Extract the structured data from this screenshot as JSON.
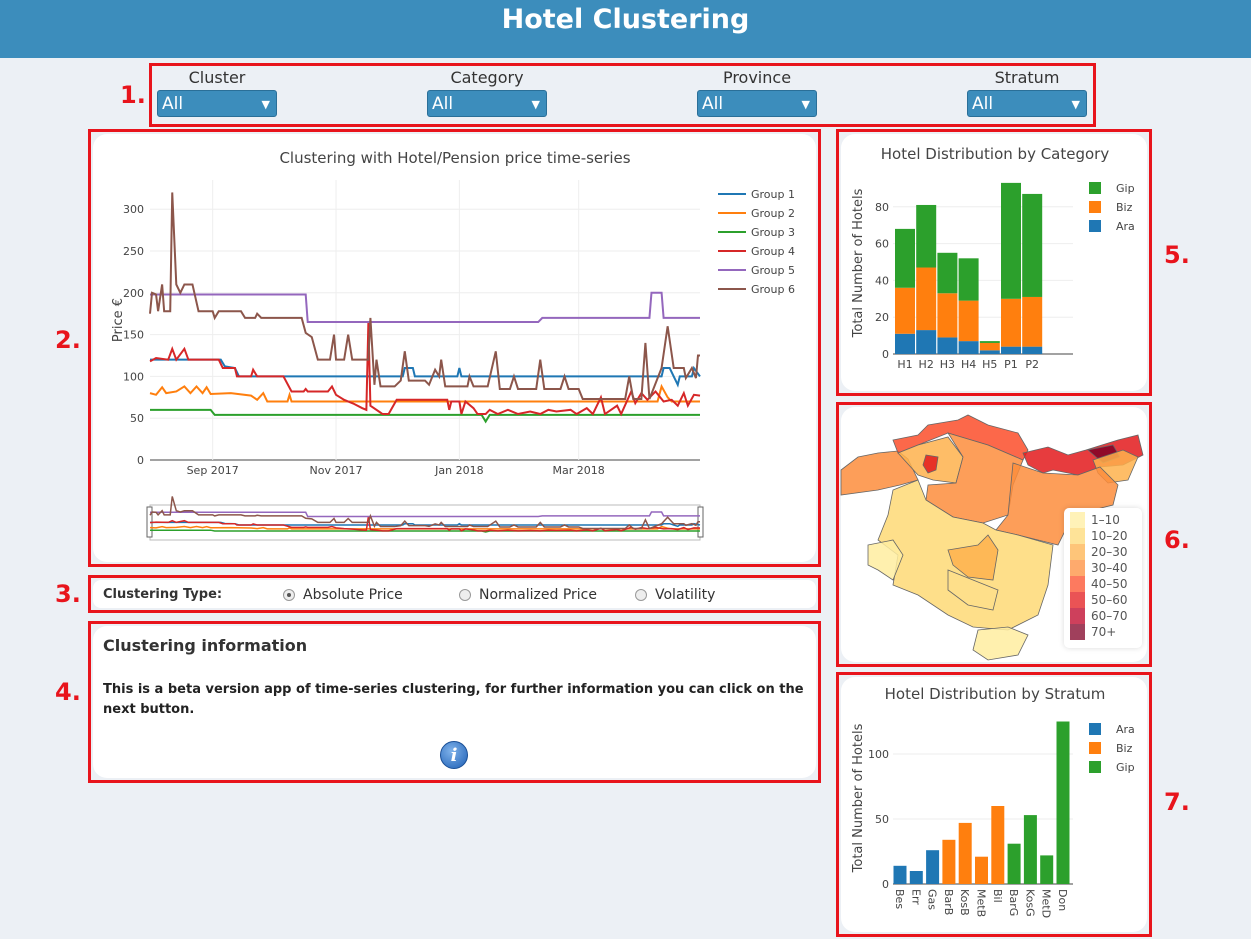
{
  "header": {
    "title": "Hotel Clustering"
  },
  "annotations": [
    "1.",
    "2.",
    "3.",
    "4.",
    "5.",
    "6.",
    "7."
  ],
  "filters": [
    {
      "label": "Cluster",
      "value": "All"
    },
    {
      "label": "Category",
      "value": "All"
    },
    {
      "label": "Province",
      "value": "All"
    },
    {
      "label": "Stratum",
      "value": "All"
    }
  ],
  "timeseries": {
    "title": "Clustering with Hotel/Pension price time-series",
    "ylabel": "Price €",
    "yticks": [
      0,
      50,
      100,
      150,
      200,
      250,
      300
    ],
    "xticks": [
      {
        "date": "2017-09-01",
        "label": "Sep 2017"
      },
      {
        "date": "2017-11-01",
        "label": "Nov 2017"
      },
      {
        "date": "2018-01-01",
        "label": "Jan 2018"
      },
      {
        "date": "2018-03-01",
        "label": "Mar 2018"
      }
    ],
    "xrange": [
      "2017-08-01",
      "2018-04-30"
    ],
    "yrange": [
      0,
      325
    ],
    "series": [
      {
        "name": "Group 1",
        "color": "#1f77b4",
        "points": [
          [
            "2017-08-01",
            120
          ],
          [
            "2017-09-05",
            120
          ],
          [
            "2017-09-07",
            112
          ],
          [
            "2017-09-12",
            110
          ],
          [
            "2017-09-14",
            100
          ],
          [
            "2017-12-04",
            100
          ],
          [
            "2017-12-05",
            110
          ],
          [
            "2017-12-09",
            110
          ],
          [
            "2017-12-10",
            100
          ],
          [
            "2017-12-31",
            100
          ],
          [
            "2018-01-01",
            110
          ],
          [
            "2018-01-02",
            100
          ],
          [
            "2018-04-11",
            100
          ],
          [
            "2018-04-12",
            110
          ],
          [
            "2018-04-15",
            110
          ],
          [
            "2018-04-17",
            100
          ],
          [
            "2018-04-19",
            90
          ],
          [
            "2018-04-20",
            100
          ],
          [
            "2018-04-26",
            100
          ],
          [
            "2018-04-27",
            110
          ],
          [
            "2018-04-30",
            100
          ]
        ]
      },
      {
        "name": "Group 2",
        "color": "#ff7f0e",
        "points": [
          [
            "2017-08-01",
            80
          ],
          [
            "2017-08-04",
            78
          ],
          [
            "2017-08-07",
            87
          ],
          [
            "2017-08-09",
            80
          ],
          [
            "2017-08-14",
            82
          ],
          [
            "2017-08-18",
            88
          ],
          [
            "2017-08-21",
            80
          ],
          [
            "2017-08-24",
            88
          ],
          [
            "2017-08-27",
            80
          ],
          [
            "2017-08-29",
            87
          ],
          [
            "2017-08-31",
            79
          ],
          [
            "2017-09-10",
            80
          ],
          [
            "2017-09-20",
            77
          ],
          [
            "2017-09-23",
            72
          ],
          [
            "2017-09-26",
            80
          ],
          [
            "2017-09-28",
            70
          ],
          [
            "2017-10-08",
            70
          ],
          [
            "2017-10-09",
            78
          ],
          [
            "2017-10-10",
            70
          ],
          [
            "2018-04-09",
            70
          ],
          [
            "2018-04-11",
            88
          ],
          [
            "2018-04-14",
            75
          ],
          [
            "2018-04-16",
            70
          ],
          [
            "2018-04-30",
            70
          ]
        ]
      },
      {
        "name": "Group 3",
        "color": "#2ca02c",
        "points": [
          [
            "2017-08-01",
            60
          ],
          [
            "2017-08-31",
            60
          ],
          [
            "2017-09-02",
            54
          ],
          [
            "2018-01-12",
            54
          ],
          [
            "2018-01-14",
            46
          ],
          [
            "2018-01-16",
            54
          ],
          [
            "2018-04-30",
            54
          ]
        ]
      },
      {
        "name": "Group 4",
        "color": "#d62728",
        "points": [
          [
            "2017-08-01",
            118
          ],
          [
            "2017-08-04",
            122
          ],
          [
            "2017-08-10",
            120
          ],
          [
            "2017-08-12",
            133
          ],
          [
            "2017-08-14",
            120
          ],
          [
            "2017-08-18",
            133
          ],
          [
            "2017-08-20",
            120
          ],
          [
            "2017-09-04",
            120
          ],
          [
            "2017-09-06",
            110
          ],
          [
            "2017-09-12",
            110
          ],
          [
            "2017-09-13",
            100
          ],
          [
            "2017-09-20",
            100
          ],
          [
            "2017-09-21",
            108
          ],
          [
            "2017-09-23",
            100
          ],
          [
            "2017-10-06",
            100
          ],
          [
            "2017-10-10",
            82
          ],
          [
            "2017-10-16",
            82
          ],
          [
            "2017-10-17",
            85
          ],
          [
            "2017-10-18",
            82
          ],
          [
            "2017-10-28",
            82
          ],
          [
            "2017-10-30",
            88
          ],
          [
            "2017-11-01",
            78
          ],
          [
            "2017-11-05",
            72
          ],
          [
            "2017-11-10",
            67
          ],
          [
            "2017-11-14",
            62
          ],
          [
            "2017-11-16",
            60
          ],
          [
            "2017-11-17",
            165
          ],
          [
            "2017-11-18",
            65
          ],
          [
            "2017-11-24",
            55
          ],
          [
            "2017-11-27",
            55
          ],
          [
            "2017-12-01",
            72
          ],
          [
            "2017-12-26",
            72
          ],
          [
            "2017-12-27",
            60
          ],
          [
            "2017-12-28",
            70
          ],
          [
            "2018-01-01",
            70
          ],
          [
            "2018-01-02",
            55
          ],
          [
            "2018-01-04",
            70
          ],
          [
            "2018-01-08",
            62
          ],
          [
            "2018-01-10",
            55
          ],
          [
            "2018-01-14",
            55
          ],
          [
            "2018-01-16",
            60
          ],
          [
            "2018-01-20",
            55
          ],
          [
            "2018-01-25",
            60
          ],
          [
            "2018-01-30",
            55
          ],
          [
            "2018-02-05",
            58
          ],
          [
            "2018-02-10",
            55
          ],
          [
            "2018-02-14",
            60
          ],
          [
            "2018-02-18",
            58
          ],
          [
            "2018-02-25",
            60
          ],
          [
            "2018-02-28",
            55
          ],
          [
            "2018-03-05",
            62
          ],
          [
            "2018-03-08",
            55
          ],
          [
            "2018-03-12",
            75
          ],
          [
            "2018-03-14",
            55
          ],
          [
            "2018-03-20",
            65
          ],
          [
            "2018-03-22",
            55
          ],
          [
            "2018-03-27",
            82
          ],
          [
            "2018-03-29",
            68
          ],
          [
            "2018-04-01",
            80
          ],
          [
            "2018-04-04",
            72
          ],
          [
            "2018-04-08",
            82
          ],
          [
            "2018-04-12",
            70
          ],
          [
            "2018-04-16",
            72
          ],
          [
            "2018-04-19",
            65
          ],
          [
            "2018-04-22",
            80
          ],
          [
            "2018-04-24",
            65
          ],
          [
            "2018-04-27",
            78
          ],
          [
            "2018-04-30",
            77
          ]
        ]
      },
      {
        "name": "Group 5",
        "color": "#9467bd",
        "points": [
          [
            "2017-08-01",
            198
          ],
          [
            "2017-10-17",
            198
          ],
          [
            "2017-10-18",
            165
          ],
          [
            "2018-02-09",
            165
          ],
          [
            "2018-02-11",
            170
          ],
          [
            "2018-04-05",
            170
          ],
          [
            "2018-04-06",
            200
          ],
          [
            "2018-04-11",
            200
          ],
          [
            "2018-04-12",
            170
          ],
          [
            "2018-04-30",
            170
          ]
        ]
      },
      {
        "name": "Group 6",
        "color": "#8c564b",
        "points": [
          [
            "2017-08-01",
            175
          ],
          [
            "2017-08-02",
            200
          ],
          [
            "2017-08-04",
            198
          ],
          [
            "2017-08-05",
            178
          ],
          [
            "2017-08-07",
            210
          ],
          [
            "2017-08-08",
            178
          ],
          [
            "2017-08-11",
            178
          ],
          [
            "2017-08-12",
            320
          ],
          [
            "2017-08-14",
            210
          ],
          [
            "2017-08-16",
            200
          ],
          [
            "2017-08-18",
            210
          ],
          [
            "2017-08-22",
            210
          ],
          [
            "2017-08-25",
            178
          ],
          [
            "2017-09-01",
            178
          ],
          [
            "2017-09-02",
            170
          ],
          [
            "2017-09-04",
            178
          ],
          [
            "2017-09-15",
            178
          ],
          [
            "2017-09-17",
            170
          ],
          [
            "2017-09-22",
            170
          ],
          [
            "2017-09-23",
            175
          ],
          [
            "2017-09-25",
            170
          ],
          [
            "2017-10-15",
            170
          ],
          [
            "2017-10-17",
            152
          ],
          [
            "2017-10-20",
            147
          ],
          [
            "2017-10-23",
            120
          ],
          [
            "2017-10-29",
            120
          ],
          [
            "2017-10-31",
            150
          ],
          [
            "2017-11-01",
            120
          ],
          [
            "2017-11-05",
            120
          ],
          [
            "2017-11-07",
            150
          ],
          [
            "2017-11-09",
            120
          ],
          [
            "2017-11-17",
            120
          ],
          [
            "2017-11-18",
            170
          ],
          [
            "2017-11-20",
            90
          ],
          [
            "2017-11-21",
            120
          ],
          [
            "2017-11-23",
            88
          ],
          [
            "2017-11-30",
            88
          ],
          [
            "2017-12-03",
            95
          ],
          [
            "2017-12-05",
            130
          ],
          [
            "2017-12-07",
            95
          ],
          [
            "2017-12-15",
            95
          ],
          [
            "2017-12-17",
            90
          ],
          [
            "2017-12-20",
            108
          ],
          [
            "2017-12-22",
            100
          ],
          [
            "2017-12-23",
            120
          ],
          [
            "2017-12-25",
            88
          ],
          [
            "2018-01-05",
            88
          ],
          [
            "2018-01-06",
            100
          ],
          [
            "2018-01-08",
            88
          ],
          [
            "2018-01-15",
            88
          ],
          [
            "2018-01-19",
            130
          ],
          [
            "2018-01-21",
            85
          ],
          [
            "2018-01-26",
            85
          ],
          [
            "2018-01-28",
            100
          ],
          [
            "2018-01-30",
            85
          ],
          [
            "2018-02-08",
            85
          ],
          [
            "2018-02-10",
            120
          ],
          [
            "2018-02-12",
            85
          ],
          [
            "2018-02-20",
            85
          ],
          [
            "2018-02-22",
            100
          ],
          [
            "2018-02-24",
            85
          ],
          [
            "2018-03-01",
            85
          ],
          [
            "2018-03-03",
            73
          ],
          [
            "2018-03-24",
            73
          ],
          [
            "2018-03-26",
            100
          ],
          [
            "2018-03-28",
            73
          ],
          [
            "2018-04-01",
            73
          ],
          [
            "2018-04-03",
            140
          ],
          [
            "2018-04-05",
            73
          ],
          [
            "2018-04-11",
            110
          ],
          [
            "2018-04-14",
            160
          ],
          [
            "2018-04-17",
            110
          ],
          [
            "2018-04-22",
            110
          ],
          [
            "2018-04-23",
            98
          ],
          [
            "2018-04-26",
            110
          ],
          [
            "2018-04-28",
            98
          ],
          [
            "2018-04-29",
            125
          ],
          [
            "2018-04-30",
            125
          ]
        ]
      }
    ]
  },
  "clustering_type": {
    "label": "Clustering Type:",
    "options": [
      {
        "label": "Absolute Price",
        "selected": true
      },
      {
        "label": "Normalized Price",
        "selected": false
      },
      {
        "label": "Volatility",
        "selected": false
      }
    ]
  },
  "info": {
    "title": "Clustering information",
    "text": "This is a beta version app of time-series clustering, for further information you can click on the next button.",
    "icon": "info-icon"
  },
  "chart_data": [
    {
      "type": "bar",
      "stacked": true,
      "title": "Hotel Distribution by Category",
      "ylabel": "Total Number of Hotels",
      "xlabel": "",
      "ylim": [
        0,
        95
      ],
      "yticks": [
        0,
        20,
        40,
        60,
        80
      ],
      "categories": [
        "H1",
        "H2",
        "H3",
        "H4",
        "H5",
        "P1",
        "P2"
      ],
      "series": [
        {
          "name": "Ara",
          "color": "#1f77b4",
          "values": [
            11,
            13,
            9,
            7,
            2,
            4,
            4
          ]
        },
        {
          "name": "Biz",
          "color": "#ff7f0e",
          "values": [
            25,
            34,
            24,
            22,
            4,
            26,
            27
          ]
        },
        {
          "name": "Gip",
          "color": "#2ca02c",
          "values": [
            32,
            34,
            22,
            23,
            1,
            63,
            56
          ]
        }
      ],
      "legend_order": [
        "Gip",
        "Biz",
        "Ara"
      ],
      "legend": "top-right"
    },
    {
      "type": "bar",
      "title": "Hotel Distribution by Stratum",
      "ylabel": "Total Number of Hotels",
      "xlabel": "",
      "ylim": [
        0,
        128
      ],
      "yticks": [
        0,
        50,
        100
      ],
      "categories": [
        "Bes",
        "Err",
        "Gas",
        "BarB",
        "KosB",
        "MetB",
        "Bil",
        "BarG",
        "KosG",
        "MetD",
        "Don"
      ],
      "values": [
        14,
        10,
        26,
        34,
        47,
        21,
        60,
        31,
        53,
        22,
        125
      ],
      "groups": [
        "Ara",
        "Ara",
        "Ara",
        "Biz",
        "Biz",
        "Biz",
        "Biz",
        "Gip",
        "Gip",
        "Gip",
        "Gip"
      ],
      "series": [
        {
          "name": "Ara",
          "color": "#1f77b4"
        },
        {
          "name": "Biz",
          "color": "#ff7f0e"
        },
        {
          "name": "Gip",
          "color": "#2ca02c"
        }
      ],
      "legend": "top-right"
    }
  ],
  "map": {
    "legend": [
      {
        "label": "1–10",
        "color": "#FFEDA0"
      },
      {
        "label": "10–20",
        "color": "#FED976"
      },
      {
        "label": "20–30",
        "color": "#FEB24C"
      },
      {
        "label": "30–40",
        "color": "#FD8D3C"
      },
      {
        "label": "40–50",
        "color": "#FC4E2A"
      },
      {
        "label": "50–60",
        "color": "#E31A1C"
      },
      {
        "label": "60–70",
        "color": "#BD0026"
      },
      {
        "label": "70+",
        "color": "#800026"
      }
    ]
  }
}
